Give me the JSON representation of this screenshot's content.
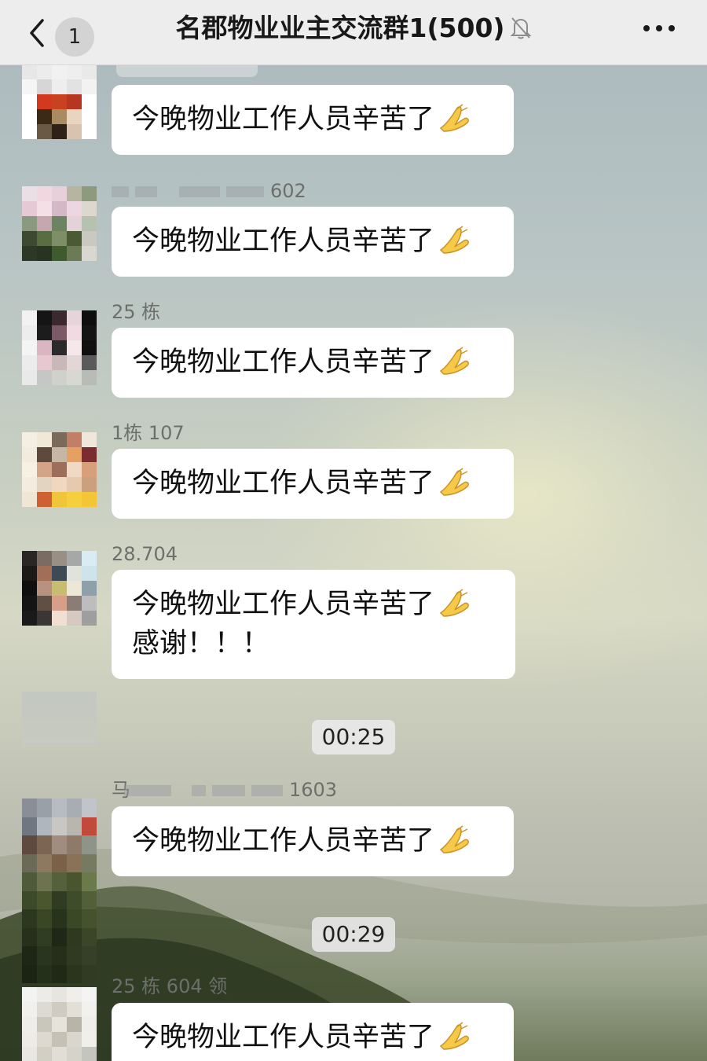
{
  "header": {
    "back_label": "",
    "unread_count": "1",
    "title": "名郡物业业主交流群1(500)",
    "mute_icon": "bell-slash-icon",
    "more_icon": "more-dots-icon"
  },
  "messages": [
    {
      "sender": "",
      "text": "今晚物业工作人员辛苦了",
      "emoji": "pray-icon"
    },
    {
      "sender": "602",
      "text": "今晚物业工作人员辛苦了",
      "emoji": "pray-icon"
    },
    {
      "sender": "25 栋",
      "text": "今晚物业工作人员辛苦了",
      "emoji": "pray-icon"
    },
    {
      "sender": "1栋 107",
      "text": "今晚物业工作人员辛苦了",
      "emoji": "pray-icon"
    },
    {
      "sender": "28.704",
      "text": "今晚物业工作人员辛苦了",
      "emoji": "pray-icon",
      "extra": "感谢！！！"
    },
    {
      "sender_prefix": "马",
      "sender": "1603",
      "text": "今晚物业工作人员辛苦了",
      "emoji": "pray-icon"
    },
    {
      "sender": "25 栋 604 领",
      "text": "今晚物业工作人员辛苦了",
      "emoji": "pray-icon"
    }
  ],
  "timestamps": [
    "00:25",
    "00:29"
  ],
  "colors": {
    "header_bg": "#ededed",
    "bubble_bg": "#ffffff",
    "badge_bg": "#d3d3d3"
  }
}
